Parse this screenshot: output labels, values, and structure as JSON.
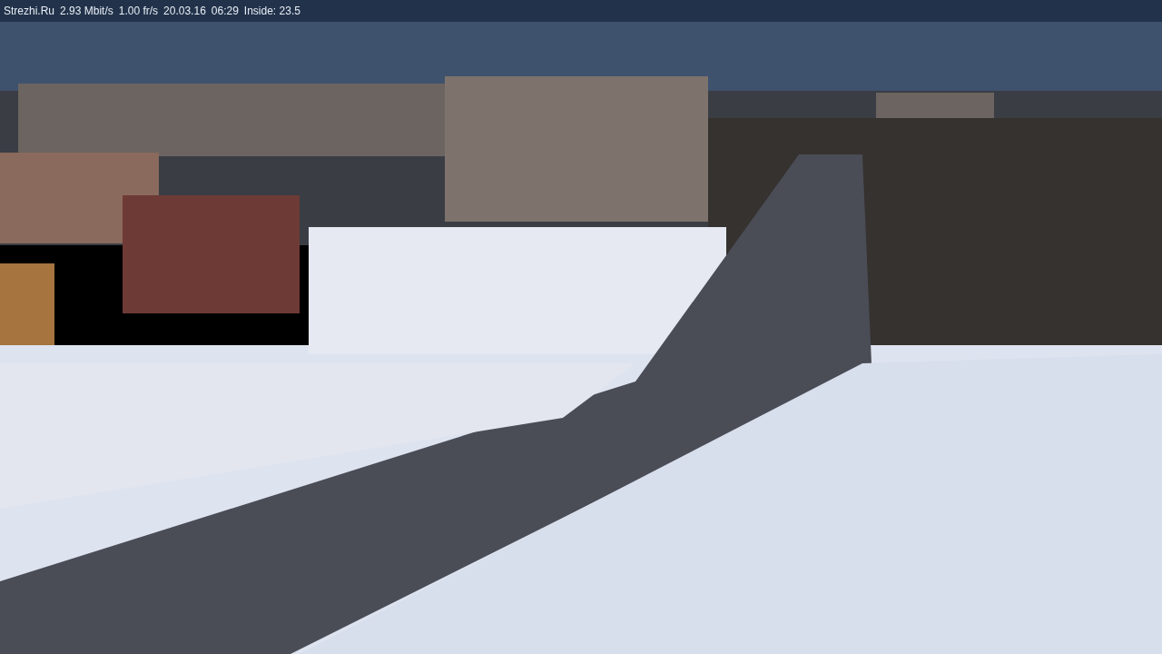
{
  "overlay": {
    "texts": [
      "Strezhi.Ru",
      "2.93 Mbit/s",
      "1.00 fr/s",
      "20.03.16",
      "06:29",
      "Inside: 23.5"
    ]
  }
}
